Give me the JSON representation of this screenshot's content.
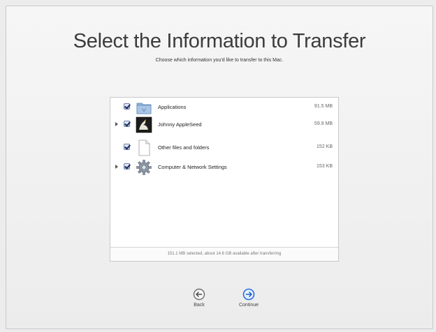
{
  "header": {
    "title": "Select the Information to Transfer",
    "subtitle": "Choose which information you'd like to transfer to this Mac."
  },
  "items": [
    {
      "label": "Applications",
      "size": "91.5 MB",
      "checked": true,
      "expandable": false,
      "icon": "applications-folder-icon"
    },
    {
      "label": "Johnny AppleSeed",
      "size": "59.9 MB",
      "checked": true,
      "expandable": true,
      "icon": "user-avatar-icon"
    },
    {
      "label": "Other files and folders",
      "size": "152 KB",
      "checked": true,
      "expandable": false,
      "icon": "document-icon"
    },
    {
      "label": "Computer & Network Settings",
      "size": "153 KB",
      "checked": true,
      "expandable": true,
      "icon": "gear-icon"
    }
  ],
  "status": "151.1 MB selected, about 14.6 GB available after transferring",
  "buttons": {
    "back": "Back",
    "continue": "Continue"
  },
  "colors": {
    "continue_accent": "#2a6fd8",
    "back_gray": "#6e6e6e"
  }
}
